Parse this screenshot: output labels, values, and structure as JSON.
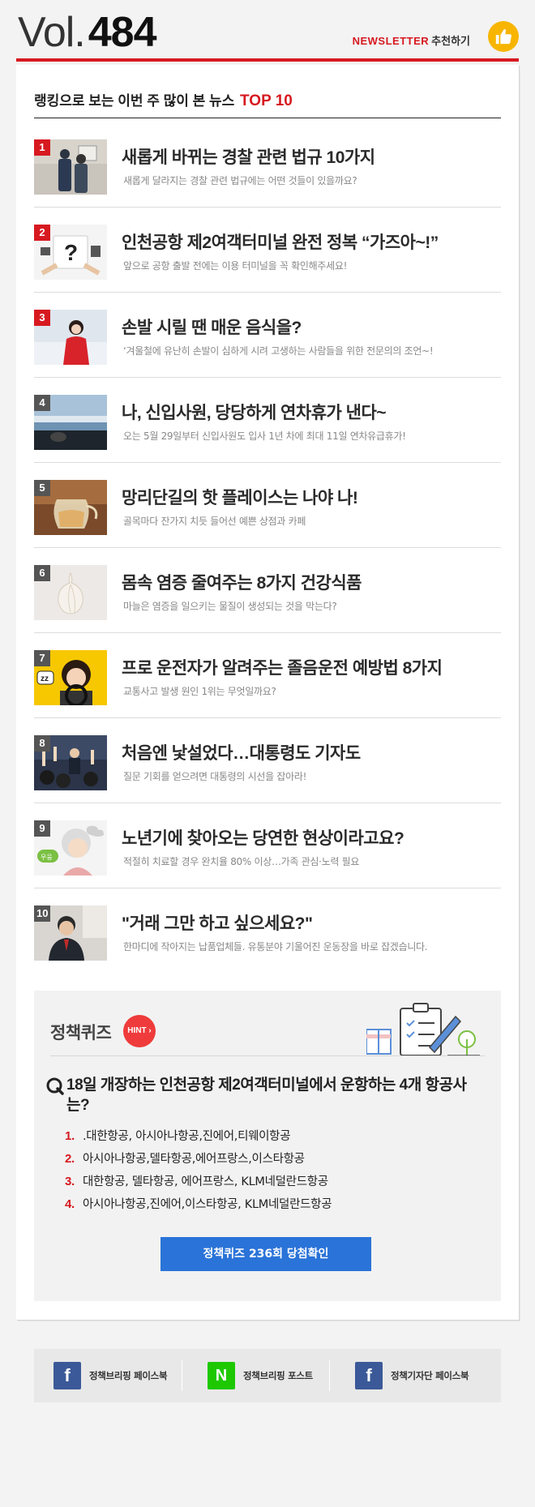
{
  "header": {
    "vol_prefix": "Vol.",
    "vol_number": "484",
    "newsletter_label": "NEWSLETTER",
    "recommend_label": "추천하기",
    "thumb_icon": "thumbs-up-icon",
    "accent_color": "#d71920"
  },
  "ranking": {
    "title": "랭킹으로 보는 이번 주 많이 본 뉴스",
    "title_highlight": "TOP 10",
    "items": [
      {
        "rank": "1",
        "title": "새롭게 바뀌는 경찰 관련 법규 10가지",
        "subtitle": "새롭게 달라지는 경찰 관련 법규에는 어떤 것들이 있을까요?"
      },
      {
        "rank": "2",
        "title": "인천공항 제2여객터미널 완전 정복 “가즈아~!”",
        "subtitle": "앞으로 공항 출발 전에는 이용 터미널을 꼭 확인해주세요!"
      },
      {
        "rank": "3",
        "title": "손발 시릴 땐 매운 음식을?",
        "subtitle": "‘겨울철에 유난히 손발이 심하게 시려 고생하는 사람들을 위한 전문의의 조언~!"
      },
      {
        "rank": "4",
        "title": "나, 신입사원, 당당하게 연차휴가 낸다~",
        "subtitle": "오는 5월 29일부터 신입사원도 입사 1년 차에 최대 11일 연차유급휴가!"
      },
      {
        "rank": "5",
        "title": "망리단길의 핫 플레이스는 나야 나!",
        "subtitle": "골목마다 잔가지 치듯 들어선 예쁜 상점과 카페"
      },
      {
        "rank": "6",
        "title": "몸속 염증 줄여주는 8가지 건강식품",
        "subtitle": "마늘은 염증을 일으키는 물질이 생성되는 것을 막는다?"
      },
      {
        "rank": "7",
        "title": "프로 운전자가 알려주는 졸음운전 예방법 8가지",
        "subtitle": "교통사고 발생 원인 1위는 무엇일까요?"
      },
      {
        "rank": "8",
        "title": "처음엔 낯설었다…대통령도 기자도",
        "subtitle": "질문 기회를 얻으려면 대통령의 시선을 잡아라!"
      },
      {
        "rank": "9",
        "title": "노년기에 찾아오는 당연한 현상이라고요?",
        "subtitle": "적절히 치료할 경우 완치율 80% 이상…가족 관심·노력 필요"
      },
      {
        "rank": "10",
        "title": "\"거래 그만 하고 싶으세요?\"",
        "subtitle": "한마디에 작아지는 납품업체들. 유통분야 기울어진 운동장을 바로 잡겠습니다."
      }
    ]
  },
  "quiz": {
    "title": "정책퀴즈",
    "hint_label": "HINT",
    "question": "18일 개장하는 인천공항 제2여객터미널에서 운항하는 4개 항공사는?",
    "options": [
      {
        "num": "1.",
        "text": ".대한항공, 아시아나항공,진에어,티웨이항공"
      },
      {
        "num": "2.",
        "text": "아시아나항공,델타항공,에어프랑스,이스타항공"
      },
      {
        "num": "3.",
        "text": "대한항공, 델타항공, 에어프랑스, KLM네덜란드항공"
      },
      {
        "num": "4.",
        "text": "아시아나항공,진에어,이스타항공, KLM네덜란드항공"
      }
    ],
    "button_label": "정책퀴즈 236회 당첨확인",
    "button_color": "#2a73d8"
  },
  "footer": {
    "links": [
      {
        "label": "정책브리핑 페이스북",
        "icon": "facebook-icon",
        "color": "#3b5998"
      },
      {
        "label": "정책브리핑 포스트",
        "icon": "naver-post-icon",
        "color": "#1ec800"
      },
      {
        "label": "정책기자단 페이스북",
        "icon": "facebook-icon",
        "color": "#3b5998"
      }
    ]
  }
}
